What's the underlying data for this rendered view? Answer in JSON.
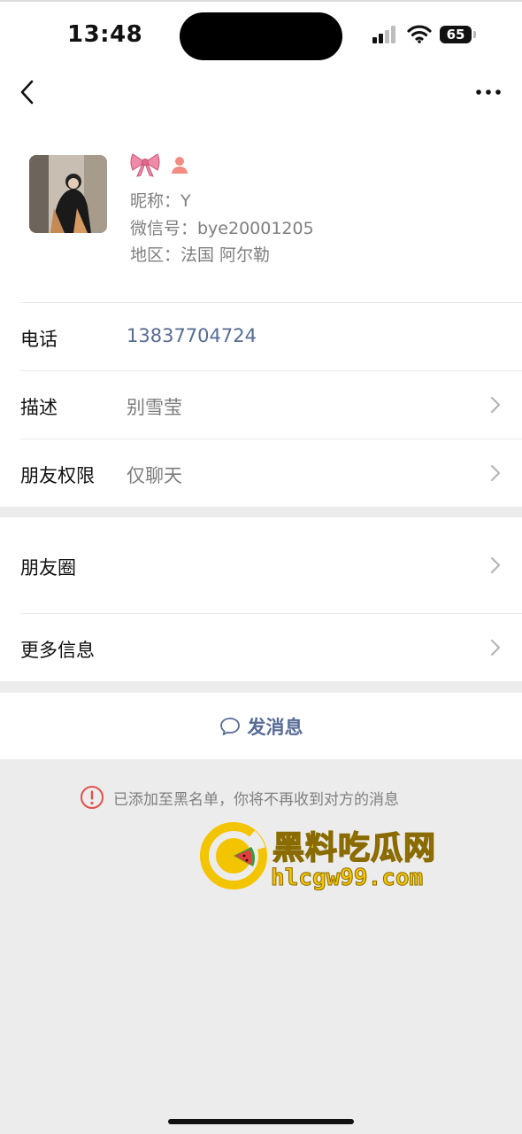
{
  "status_bar": {
    "time": "13:48",
    "battery": "65"
  },
  "profile": {
    "nickname": "昵称：Y",
    "wechat_id": "微信号：bye20001205",
    "region": "地区：法国 阿尔勒"
  },
  "rows": {
    "phone": {
      "label": "电话",
      "value": "13837704724"
    },
    "description": {
      "label": "描述",
      "value": "别雪莹"
    },
    "permission": {
      "label": "朋友权限",
      "value": "仅聊天"
    },
    "moments": {
      "label": "朋友圈"
    },
    "more_info": {
      "label": "更多信息"
    }
  },
  "actions": {
    "send_message": "发消息"
  },
  "notice": "已添加至黑名单，你将不再收到对方的消息",
  "watermark": {
    "title": "黑料吃瓜网",
    "url": "hlcgw99.com"
  },
  "colors": {
    "link": "#576b95",
    "warning": "#e0504a",
    "watermark": "#f3c400"
  }
}
